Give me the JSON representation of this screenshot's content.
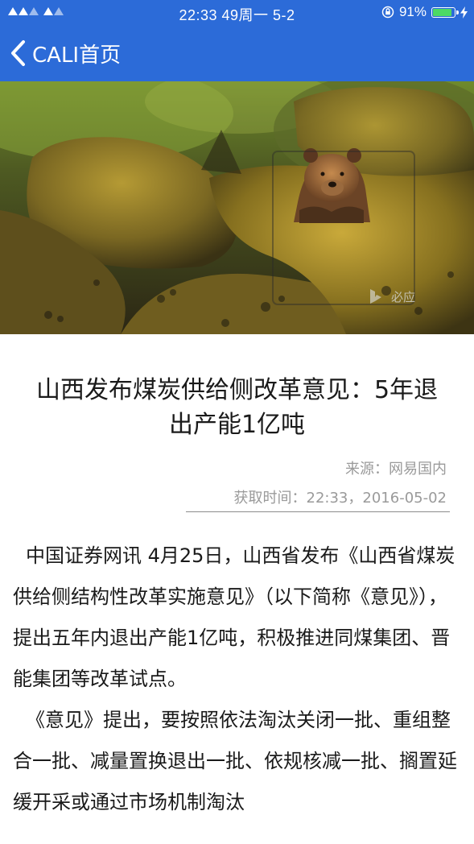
{
  "status_bar": {
    "time": "22:33",
    "extra": "49周一 5-2",
    "battery": "91%",
    "battery_level": 0.91
  },
  "nav": {
    "back_label": "CALI首页"
  },
  "hero": {
    "watermark": "必应"
  },
  "article": {
    "title": "山西发布煤炭供给侧改革意见：5年退出产能1亿吨",
    "source": "来源：网易国内",
    "fetched_time": "获取时间：22:33，2016-05-02",
    "paragraphs": [
      "中国证券网讯 4月25日，山西省发布《山西省煤炭供给侧结构性改革实施意见》（以下简称《意见》），提出五年内退出产能1亿吨，积极推进同煤集团、晋能集团等改革试点。",
      "《意见》提出，要按照依法淘汰关闭一批、重组整合一批、减量置换退出一批、依规核减一批、搁置延缓开采或通过市场机制淘汰"
    ]
  }
}
